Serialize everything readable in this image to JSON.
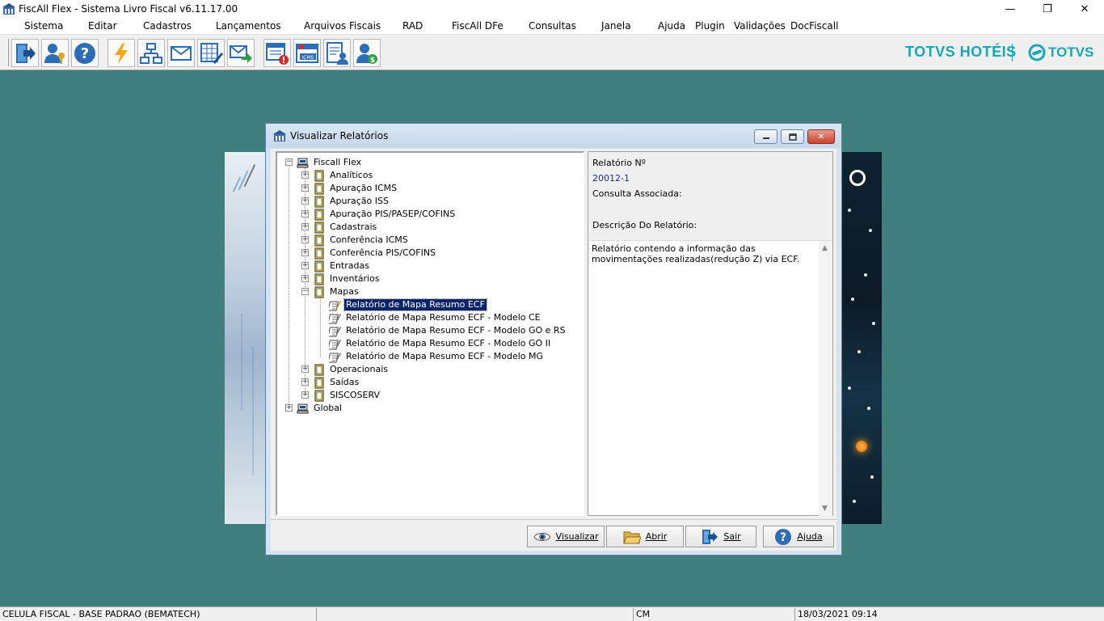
{
  "window": {
    "title": "FiscAll Flex - Sistema Livro Fiscal v6.11.17.00",
    "min": "—",
    "max": "❐",
    "close": "✕"
  },
  "menu": [
    "Sistema",
    "Editar",
    "Cadastros",
    "Lançamentos",
    "Arquivos Fiscais",
    "RAD",
    "FiscAll DFe",
    "Consultas",
    "Janela",
    "Ajuda",
    "Plugin",
    "Validações",
    "DocFiscall"
  ],
  "toolbar": {
    "icons": [
      "exit-icon",
      "user-key-icon",
      "help-icon",
      "lightning-icon",
      "network-icon",
      "mail-icon",
      "spreadsheet-edit-icon",
      "mail-send-icon",
      "window-alert-icon",
      "icms-calendar-icon",
      "document-user-icon",
      "user-money-icon"
    ]
  },
  "brand": {
    "left": "TOTVS HOTÉIS",
    "right": "TOTVS",
    "color": "#1aa6b7"
  },
  "dialog": {
    "title": "Visualizar Relatórios",
    "close_glyph": "✕",
    "tree": {
      "root": "Fiscall Flex",
      "folders": [
        "Analíticos",
        "Apuração ICMS",
        "Apuração ISS",
        "Apuração PIS/PASEP/COFINS",
        "Cadastrais",
        "Conferência ICMS",
        "Conferência PIS/COFINS",
        "Entradas",
        "Inventários",
        "Mapas"
      ],
      "mapas_children": [
        "Relatório de Mapa Resumo ECF",
        "Relatório de Mapa Resumo ECF - Modelo CE",
        "Relatório de Mapa Resumo ECF - Modelo GO e RS",
        "Relatório de Mapa Resumo ECF - Modelo GO II",
        "Relatório de Mapa Resumo ECF - Modelo MG"
      ],
      "folders_after": [
        "Operacionais",
        "Saídas",
        "SISCOSERV"
      ],
      "global": "Global",
      "selected": "Relatório de Mapa Resumo ECF"
    },
    "details": {
      "report_no_label": "Relatório Nº",
      "report_no": "20012-1",
      "query_label": "Consulta Associada:",
      "description_label": "Descrição Do Relatório:",
      "description": "Relatório contendo a informação das movimentações realizadas(redução Z) via ECF."
    },
    "buttons": {
      "view": "Visualizar",
      "open": "Abrir",
      "exit": "Sair",
      "help": "Ajuda"
    }
  },
  "status": {
    "cell": "CELULA FISCAL - BASE PADRAO (BEMATECH)",
    "mode": "CM",
    "datetime": "18/03/2021 09:14"
  }
}
